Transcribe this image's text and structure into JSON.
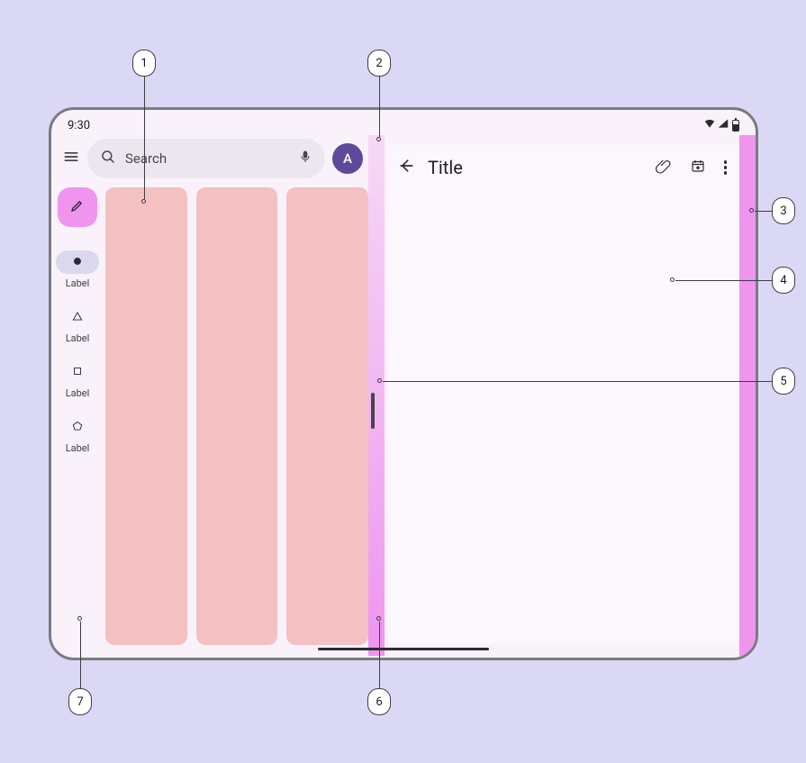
{
  "status": {
    "time": "9:30"
  },
  "search": {
    "placeholder": "Search"
  },
  "avatar": {
    "initial": "A"
  },
  "nav": {
    "items": [
      {
        "label": "Label"
      },
      {
        "label": "Label"
      },
      {
        "label": "Label"
      },
      {
        "label": "Label"
      }
    ]
  },
  "detail": {
    "title": "Title"
  },
  "callouts": {
    "c1": "1",
    "c2": "2",
    "c3": "3",
    "c4": "4",
    "c5": "5",
    "c6": "6",
    "c7": "7"
  }
}
